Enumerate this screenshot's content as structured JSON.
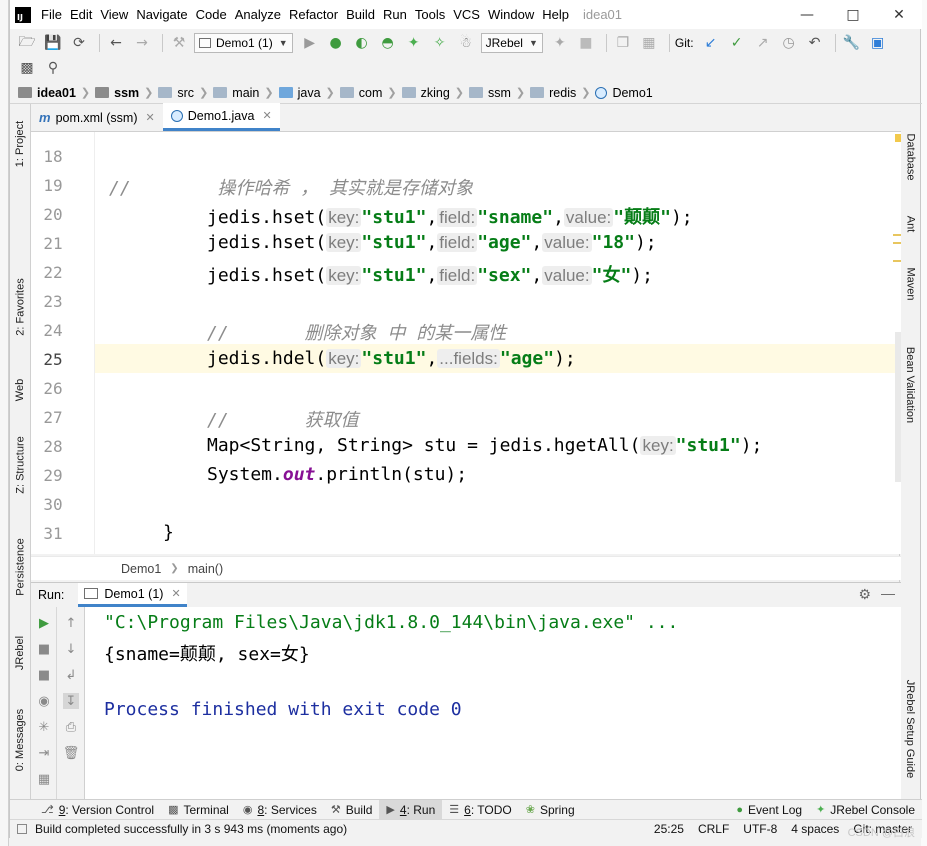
{
  "window": {
    "title": "idea01",
    "menu": [
      "File",
      "Edit",
      "View",
      "Navigate",
      "Code",
      "Analyze",
      "Refactor",
      "Build",
      "Run",
      "Tools",
      "VCS",
      "Window",
      "Help"
    ]
  },
  "toolbar": {
    "run_config": "Demo1 (1)",
    "jrebel_combo": "JRebel",
    "git_label": "Git:"
  },
  "breadcrumb": [
    "idea01",
    "ssm",
    "src",
    "main",
    "java",
    "com",
    "zking",
    "ssm",
    "redis",
    "Demo1"
  ],
  "left_stripe": [
    "1: Project",
    "2: Favorites",
    "Web",
    "Z: Structure",
    "Persistence",
    "JRebel",
    "0: Messages"
  ],
  "right_stripe": [
    "Database",
    "Ant",
    "Maven",
    "Bean Validation",
    "JRebel Setup Guide"
  ],
  "tabs": [
    {
      "label": "pom.xml (ssm)",
      "active": false
    },
    {
      "label": "Demo1.java",
      "active": true
    }
  ],
  "editor": {
    "line_numbers": [
      "18",
      "19",
      "20",
      "21",
      "22",
      "23",
      "24",
      "25",
      "26",
      "27",
      "28",
      "29",
      "30",
      "31"
    ],
    "current_line": "25",
    "line19_comment": "//        操作哈希 ， 其实就是存储对象",
    "hset": [
      {
        "key": "\"stu1\"",
        "field": "\"sname\"",
        "value": "\"颠颠\""
      },
      {
        "key": "\"stu1\"",
        "field": "\"age\"",
        "value": "\"18\""
      },
      {
        "key": "\"stu1\"",
        "field": "\"sex\"",
        "value": "\"女\""
      }
    ],
    "line24_comment": "//       删除对象 中 的某一属性",
    "hdel_key": "\"stu1\"",
    "hdel_field": "\"age\"",
    "line27_comment": "//       获取值",
    "line28_prefix": "Map<String, String> stu = jedis.hgetAll(",
    "line28_key": "\"stu1\"",
    "line29_a": "System.",
    "line29_field": "out",
    "line29_b": ".println(stu);",
    "line31": "}",
    "hints": {
      "key": "key:",
      "field": "field:",
      "value": "value:",
      "fields": "...fields:"
    }
  },
  "editor_breadcrumb": [
    "Demo1",
    "main()"
  ],
  "run": {
    "label": "Run:",
    "tab": "Demo1 (1)",
    "output": [
      "\"C:\\Program Files\\Java\\jdk1.8.0_144\\bin\\java.exe\" ...",
      "{sname=颠颠, sex=女}",
      "",
      "Process finished with exit code 0"
    ]
  },
  "tool_buttons": [
    {
      "num": "9",
      "label": ": Version Control"
    },
    {
      "num": "",
      "label": "Terminal"
    },
    {
      "num": "8",
      "label": ": Services"
    },
    {
      "num": "",
      "label": "Build"
    },
    {
      "num": "4",
      "label": ": Run"
    },
    {
      "num": "6",
      "label": ": TODO"
    },
    {
      "num": "",
      "label": "Spring"
    }
  ],
  "tool_buttons_right": [
    "Event Log",
    "JRebel Console"
  ],
  "status": {
    "message": "Build completed successfully in 3 s 943 ms (moments ago)",
    "position": "25:25",
    "line_sep": "CRLF",
    "encoding": "UTF-8",
    "indent": "4 spaces",
    "vcs": "Git: master"
  },
  "watermark": "CSDN @白浪"
}
